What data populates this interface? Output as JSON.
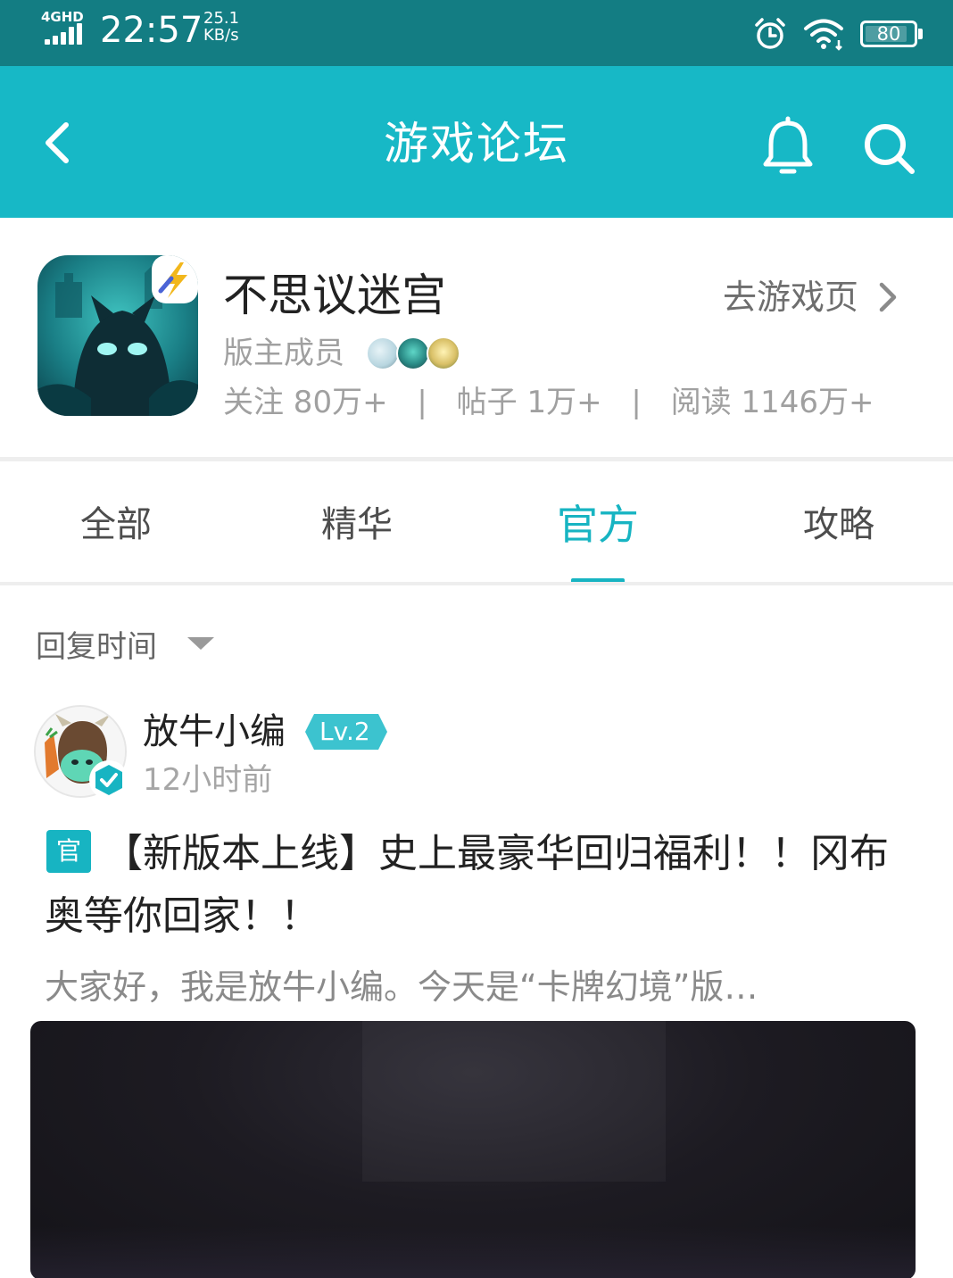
{
  "status_bar": {
    "network": "4GHD",
    "time": "22:57",
    "speed_value": "25.1",
    "speed_unit": "KB/s",
    "battery": "80",
    "icons": [
      "alarm-icon",
      "wifi-icon",
      "battery-icon"
    ]
  },
  "nav": {
    "title": "游戏论坛",
    "back_icon": "chevron-left-icon",
    "bell_icon": "bell-icon",
    "search_icon": "search-icon"
  },
  "game": {
    "name": "不思议迷宫",
    "goto_label": "去游戏页",
    "moderator_label": "版主成员",
    "stats": {
      "follow": "关注 80万+",
      "posts": "帖子 1万+",
      "reads": "阅读 1146万+",
      "separator": "|"
    }
  },
  "tabs": [
    {
      "label": "全部",
      "active": false
    },
    {
      "label": "精华",
      "active": false
    },
    {
      "label": "官方",
      "active": true
    },
    {
      "label": "攻略",
      "active": false
    }
  ],
  "sort": {
    "label": "回复时间"
  },
  "post": {
    "author": "放牛小编",
    "level": "Lv.2",
    "time": "12小时前",
    "badge": "官",
    "title": "【新版本上线】史上最豪华回归福利！！冈布奥等你回家！！",
    "excerpt": "大家好，我是放牛小编。今天是“卡牌幻境”版…"
  },
  "colors": {
    "status_bar": "#137d83",
    "nav": "#17b8c6",
    "accent": "#17b4c2"
  }
}
